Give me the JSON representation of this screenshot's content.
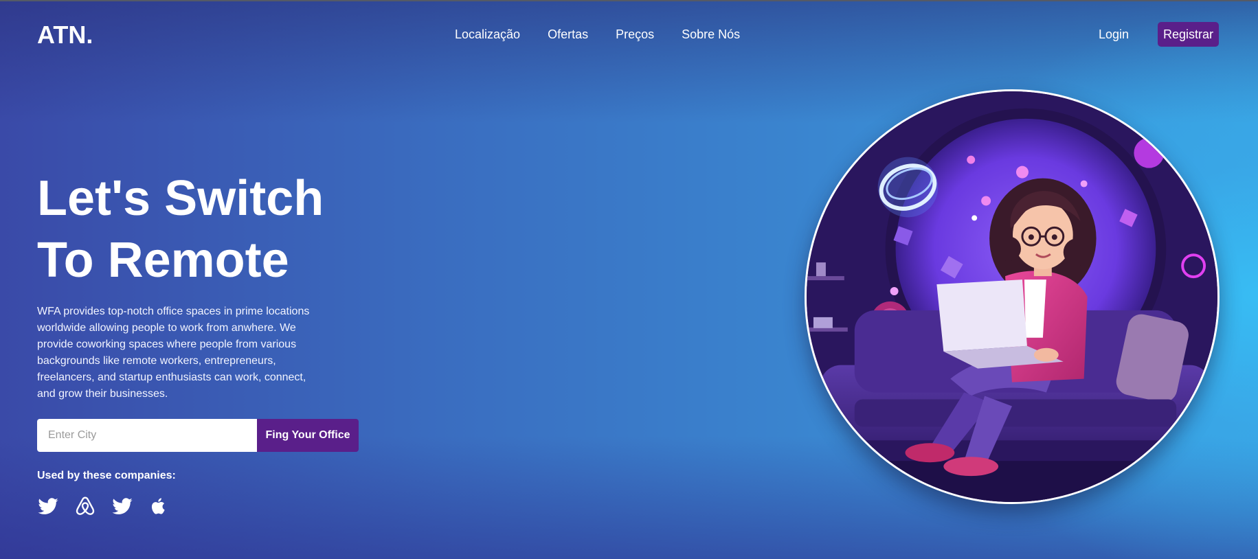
{
  "brand": {
    "logo": "ATN."
  },
  "nav": {
    "links": [
      "Localização",
      "Ofertas",
      "Preços",
      "Sobre Nós"
    ],
    "login": "Login",
    "register": "Registrar"
  },
  "hero": {
    "title_line1": "Let's Switch",
    "title_line2": "To Remote",
    "description": "WFA provides top-notch office spaces in prime locations worldwide allowing people to work from anwhere. We provide coworking spaces where people from various backgrounds like remote workers, entrepreneurs, freelancers, and startup enthusiasts can work, connect, and grow their businesses.",
    "search": {
      "placeholder": "Enter City",
      "button": "Fing Your Office"
    },
    "companies_label": "Used by these companies:",
    "company_icons": [
      "twitter-icon",
      "airbnb-icon",
      "twitter-icon",
      "apple-icon"
    ]
  },
  "illustration": {
    "icon": "woman-with-laptop-illustration"
  },
  "colors": {
    "accent": "#5a1f8a",
    "bg_left": "#3a4aa8",
    "bg_right": "#38bef5"
  }
}
